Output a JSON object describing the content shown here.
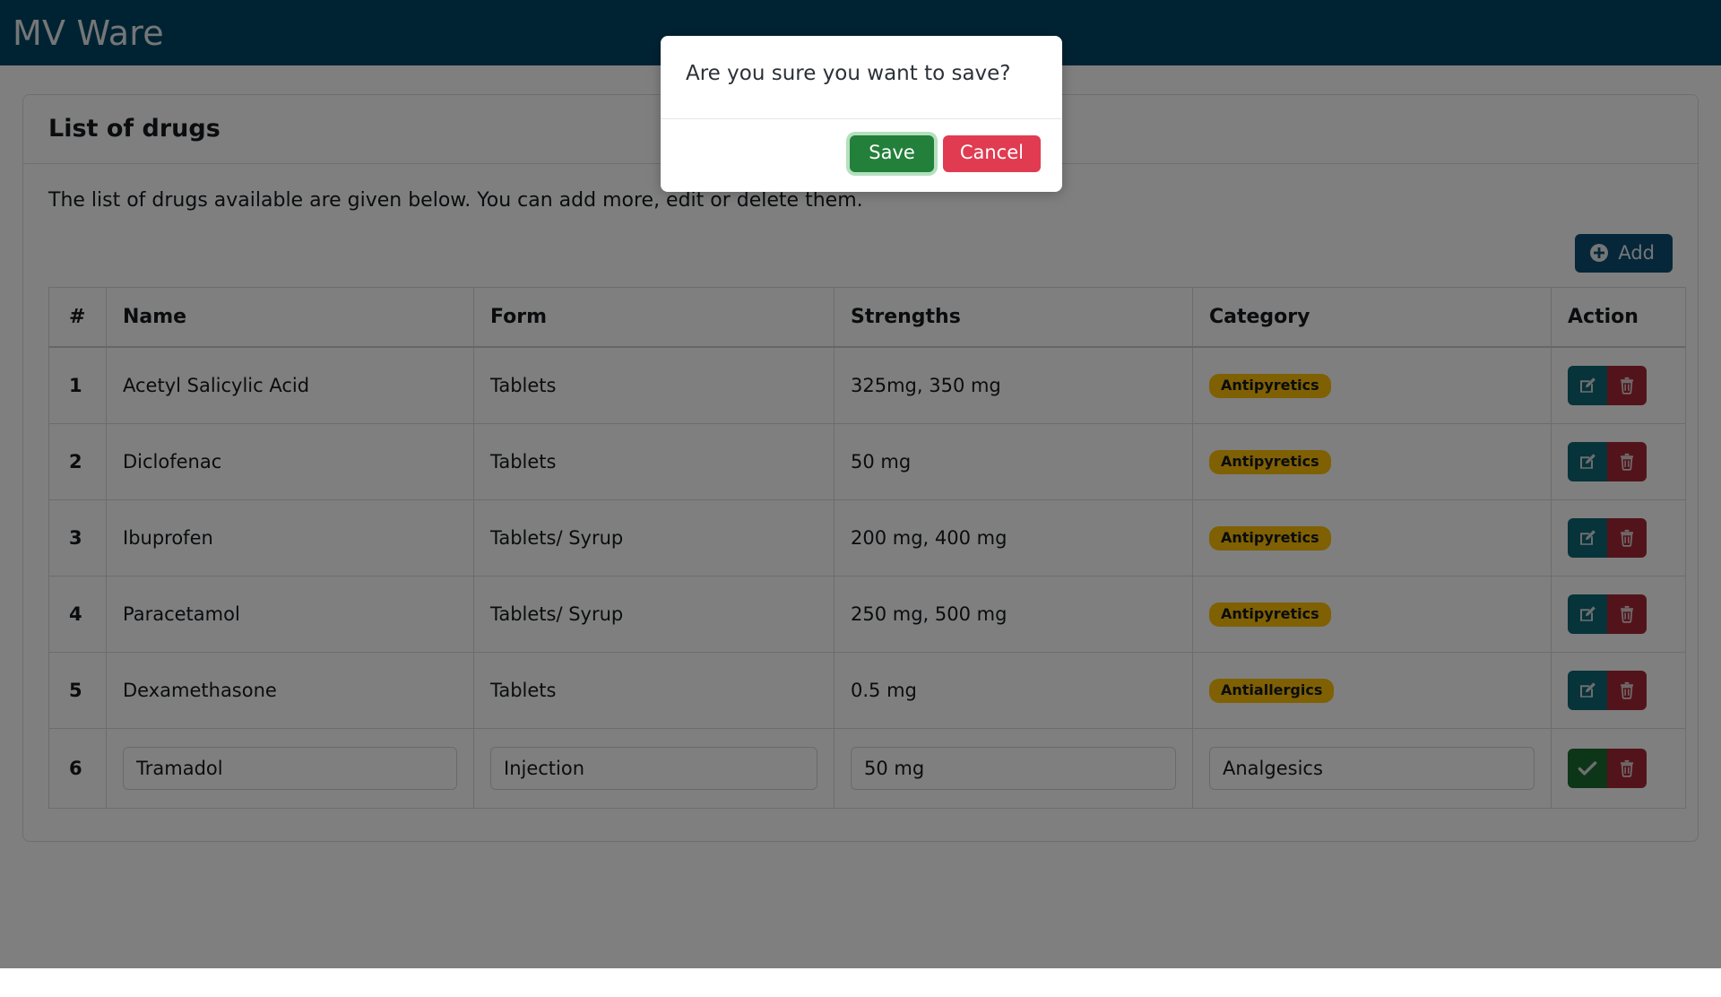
{
  "navbar": {
    "brand": "MV Ware",
    "background": "#004666"
  },
  "card": {
    "title": "List of drugs",
    "description": "The list of drugs available are given below. You can add more, edit or delete them."
  },
  "toolbar": {
    "add_label": "Add",
    "add_icon": "plus-circle-icon",
    "add_color": "#0b4f73"
  },
  "table": {
    "columns": [
      "#",
      "Name",
      "Form",
      "Strengths",
      "Category",
      "Action"
    ],
    "rows": [
      {
        "index": "1",
        "name": "Acetyl Salicylic Acid",
        "form": "Tablets",
        "strengths": "325mg, 350 mg",
        "category": "Antipyretics",
        "editing": false,
        "actions": [
          "edit-icon",
          "trash-icon"
        ]
      },
      {
        "index": "2",
        "name": "Diclofenac",
        "form": "Tablets",
        "strengths": "50 mg",
        "category": "Antipyretics",
        "editing": false,
        "actions": [
          "edit-icon",
          "trash-icon"
        ]
      },
      {
        "index": "3",
        "name": "Ibuprofen",
        "form": "Tablets/ Syrup",
        "strengths": "200 mg, 400 mg",
        "category": "Antipyretics",
        "editing": false,
        "actions": [
          "edit-icon",
          "trash-icon"
        ]
      },
      {
        "index": "4",
        "name": "Paracetamol",
        "form": "Tablets/ Syrup",
        "strengths": "250 mg, 500 mg",
        "category": "Antipyretics",
        "editing": false,
        "actions": [
          "edit-icon",
          "trash-icon"
        ]
      },
      {
        "index": "5",
        "name": "Dexamethasone",
        "form": "Tablets",
        "strengths": "0.5 mg",
        "category": "Antiallergics",
        "editing": false,
        "actions": [
          "edit-icon",
          "trash-icon"
        ]
      },
      {
        "index": "6",
        "name": "Tramadol",
        "form": "Injection",
        "strengths": "50 mg",
        "category": "Analgesics",
        "editing": true,
        "actions": [
          "check-icon",
          "trash-icon"
        ]
      }
    ],
    "badge_color": "#ffc107",
    "edit_button_color": "#0f6674",
    "accept_button_color": "#1b6b30",
    "delete_button_color": "#a52834"
  },
  "modal": {
    "question": "Are you sure you want to save?",
    "save_label": "Save",
    "cancel_label": "Cancel",
    "save_color": "#22803a",
    "cancel_color": "#e13b51",
    "focused_button": "Save"
  }
}
